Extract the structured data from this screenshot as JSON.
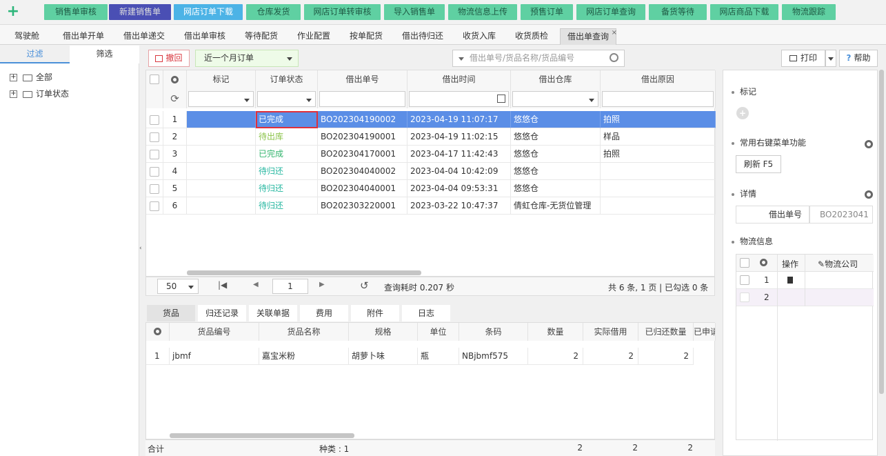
{
  "topbar": {
    "add": "+",
    "buttons": [
      "销售单审核",
      "新建销售单",
      "网店订单下载",
      "仓库发货",
      "网店订单转审核",
      "导入销售单",
      "物流信息上传",
      "预售订单",
      "网店订单查询",
      "备货等待",
      "网店商品下载",
      "物流跟踪"
    ]
  },
  "tabs": [
    "驾驶舱",
    "借出单开单",
    "借出单递交",
    "借出单审核",
    "等待配货",
    "作业配置",
    "按单配货",
    "借出待归还",
    "收货入库",
    "收货质检",
    "借出单查询"
  ],
  "tab_close": "×",
  "left": {
    "tab_filter": "过滤",
    "tab_select": "筛选",
    "tree": [
      "全部",
      "订单状态"
    ],
    "expand": "+"
  },
  "actions": {
    "revoke": "撤回",
    "period": "近一个月订单",
    "search_placeholder": "借出单号/货品名称/货品编号",
    "print": "打印",
    "help": "帮助"
  },
  "grid": {
    "headers": [
      "标记",
      "订单状态",
      "借出单号",
      "借出时间",
      "借出仓库",
      "借出原因"
    ],
    "rows": [
      {
        "no": "1",
        "status": "已完成",
        "status_color": "#ffffff",
        "order": "BO202304190002",
        "time": "2023-04-19 11:07:17",
        "warehouse": "悠悠仓",
        "reason": "拍照"
      },
      {
        "no": "2",
        "status": "待出库",
        "status_color": "#8bc34a",
        "order": "BO202304190001",
        "time": "2023-04-19 11:02:15",
        "warehouse": "悠悠仓",
        "reason": "样品"
      },
      {
        "no": "3",
        "status": "已完成",
        "status_color": "#34b56e",
        "order": "BO202304170001",
        "time": "2023-04-17 11:42:43",
        "warehouse": "悠悠仓",
        "reason": "拍照"
      },
      {
        "no": "4",
        "status": "待归还",
        "status_color": "#26b7a0",
        "order": "BO202304040002",
        "time": "2023-04-04 10:42:09",
        "warehouse": "悠悠仓",
        "reason": ""
      },
      {
        "no": "5",
        "status": "待归还",
        "status_color": "#26b7a0",
        "order": "BO202304040001",
        "time": "2023-04-04 09:53:31",
        "warehouse": "悠悠仓",
        "reason": ""
      },
      {
        "no": "6",
        "status": "待归还",
        "status_color": "#26b7a0",
        "order": "BO202303220001",
        "time": "2023-03-22 10:47:37",
        "warehouse": "倩虹仓库-无货位管理",
        "reason": ""
      }
    ]
  },
  "pager": {
    "size": "50",
    "page": "1",
    "timing": "查询耗时 0.207 秒",
    "summary": "共 6 条, 1 页 | 已勾选 0 条"
  },
  "bottom": {
    "tabs": [
      "货品",
      "归还记录",
      "关联单据",
      "费用",
      "附件",
      "日志"
    ],
    "headers": [
      "货品编号",
      "货品名称",
      "规格",
      "单位",
      "条码",
      "数量",
      "实际借用",
      "已归还数量",
      "已申请"
    ],
    "rows": [
      {
        "no": "1",
        "code": "jbmf",
        "name": "嘉宝米粉",
        "spec": "胡萝卜味",
        "unit": "瓶",
        "barcode": "NBjbmf575",
        "qty": "2",
        "actual": "2",
        "returned": "2"
      }
    ],
    "footer": {
      "total_label": "合计",
      "kinds": "种类 : 1",
      "qty": "2",
      "actual": "2",
      "returned": "2"
    }
  },
  "right": {
    "mark": "标记",
    "menu": "常用右键菜单功能",
    "refresh": "刷新 F5",
    "detail": "详情",
    "order_label": "借出单号",
    "order_value": "BO2023041",
    "logistics": "物流信息",
    "op": "操作",
    "company": "物流公司",
    "lrows": [
      "1",
      "2"
    ]
  }
}
